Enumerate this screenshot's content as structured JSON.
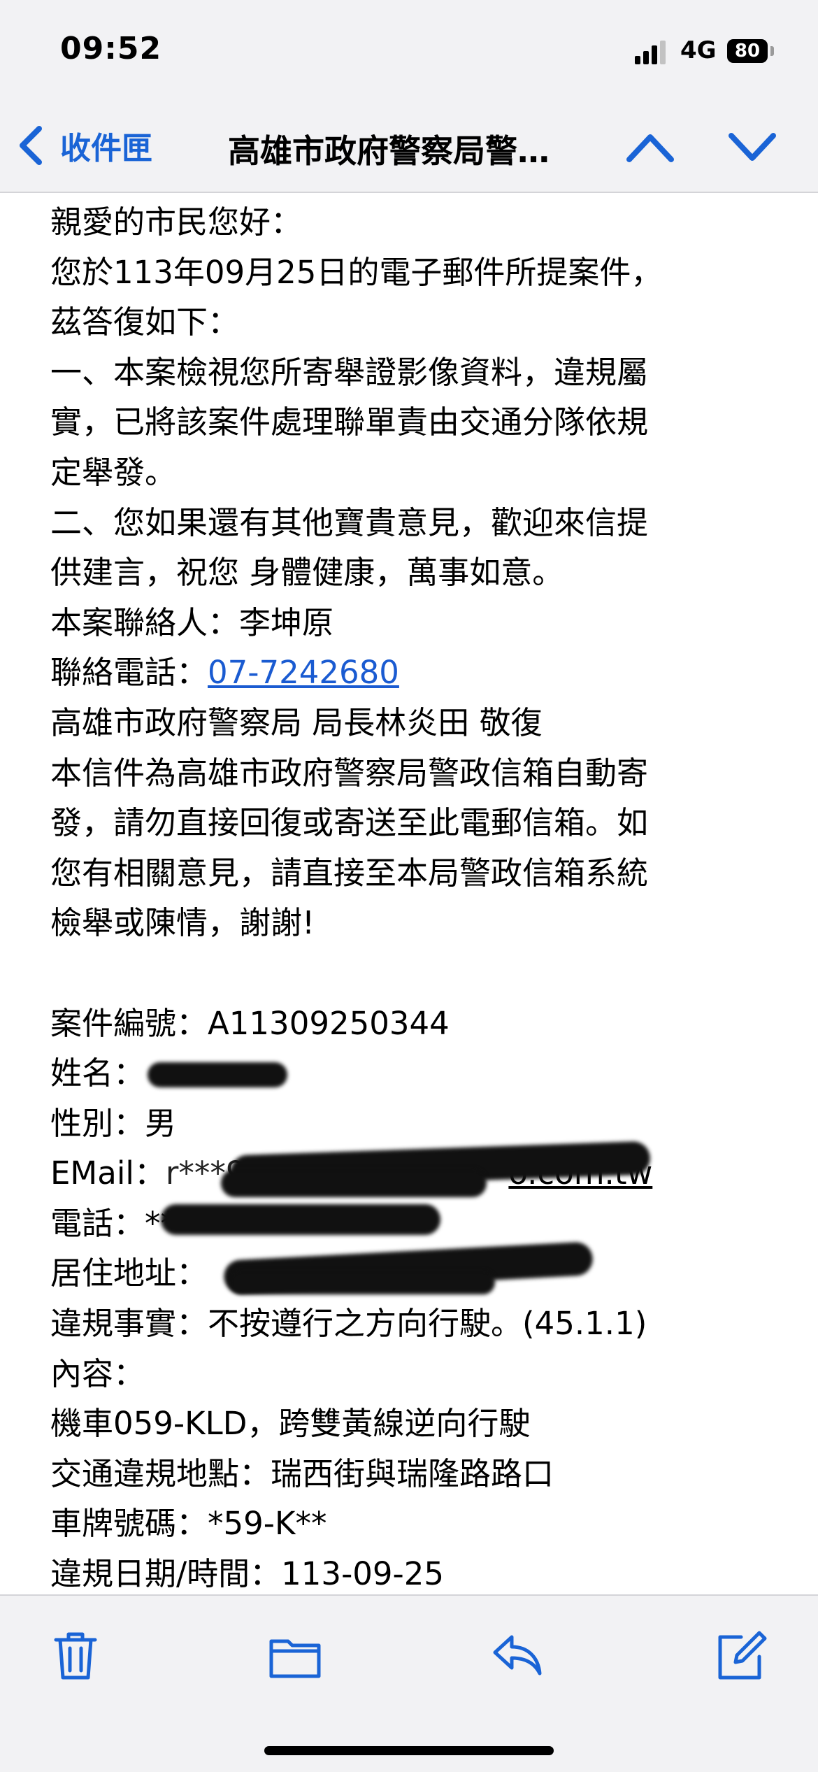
{
  "status_bar": {
    "time": "09:52",
    "network": "4G",
    "battery": "80"
  },
  "nav": {
    "back_label": "收件匣",
    "title": "高雄市政府警察局警…",
    "icons": [
      "chevron-left-icon",
      "chevron-up-icon",
      "chevron-down-icon"
    ]
  },
  "email": {
    "lines": [
      "親愛的市民您好：",
      "您於113年09月25日的電子郵件所提案件，",
      "茲答復如下：",
      "一、本案檢視您所寄舉證影像資料，違規屬",
      "實，已將該案件處理聯單責由交通分隊依規",
      "定舉發。",
      "二、您如果還有其他寶貴意見，歡迎來信提",
      "供建言，祝您 身體健康，萬事如意。",
      "本案聯絡人：李坤原"
    ],
    "phone_prefix": "聯絡電話：",
    "phone": "07-7242680",
    "signature": "高雄市政府警察局 局長林炎田 敬復",
    "notice_lines": [
      "本信件為高雄市政府警察局警政信箱自動寄",
      "發，請勿直接回復或寄送至此電郵信箱。如",
      "您有相關意見，請直接至本局警政信箱系統",
      "檢舉或陳情，謝謝!"
    ],
    "case_no_label": "案件編號：",
    "case_no": "A11309250344",
    "name_label": "姓名：",
    "name_value": "",
    "gender_label": "性別：",
    "gender": "男",
    "email_label": "EMail：",
    "email_value": "r***9403",
    "email_suffix": "o.com.tw",
    "phone_label": "電話：",
    "phone_value": "**",
    "address_label": "居住地址：",
    "address_value": "",
    "violation_label": "違規事實：",
    "violation": "不按遵行之方向行駛。(45.1.1)",
    "content_label": "內容：",
    "content": "機車059-KLD，跨雙黃線逆向行駛",
    "location_label": "交通違規地點：",
    "location": "瑞西街與瑞隆路路口",
    "plate_label": "車牌號碼：",
    "plate": "*59-K**",
    "datetime_label": "違規日期/時間：",
    "datetime": "113-09-25"
  },
  "toolbar": {
    "icons": [
      "trash-icon",
      "folder-icon",
      "reply-icon",
      "compose-icon"
    ]
  },
  "colors": {
    "accent": "#1a64d6",
    "link": "#1a5bd1",
    "bar_bg": "#f2f2f4"
  }
}
